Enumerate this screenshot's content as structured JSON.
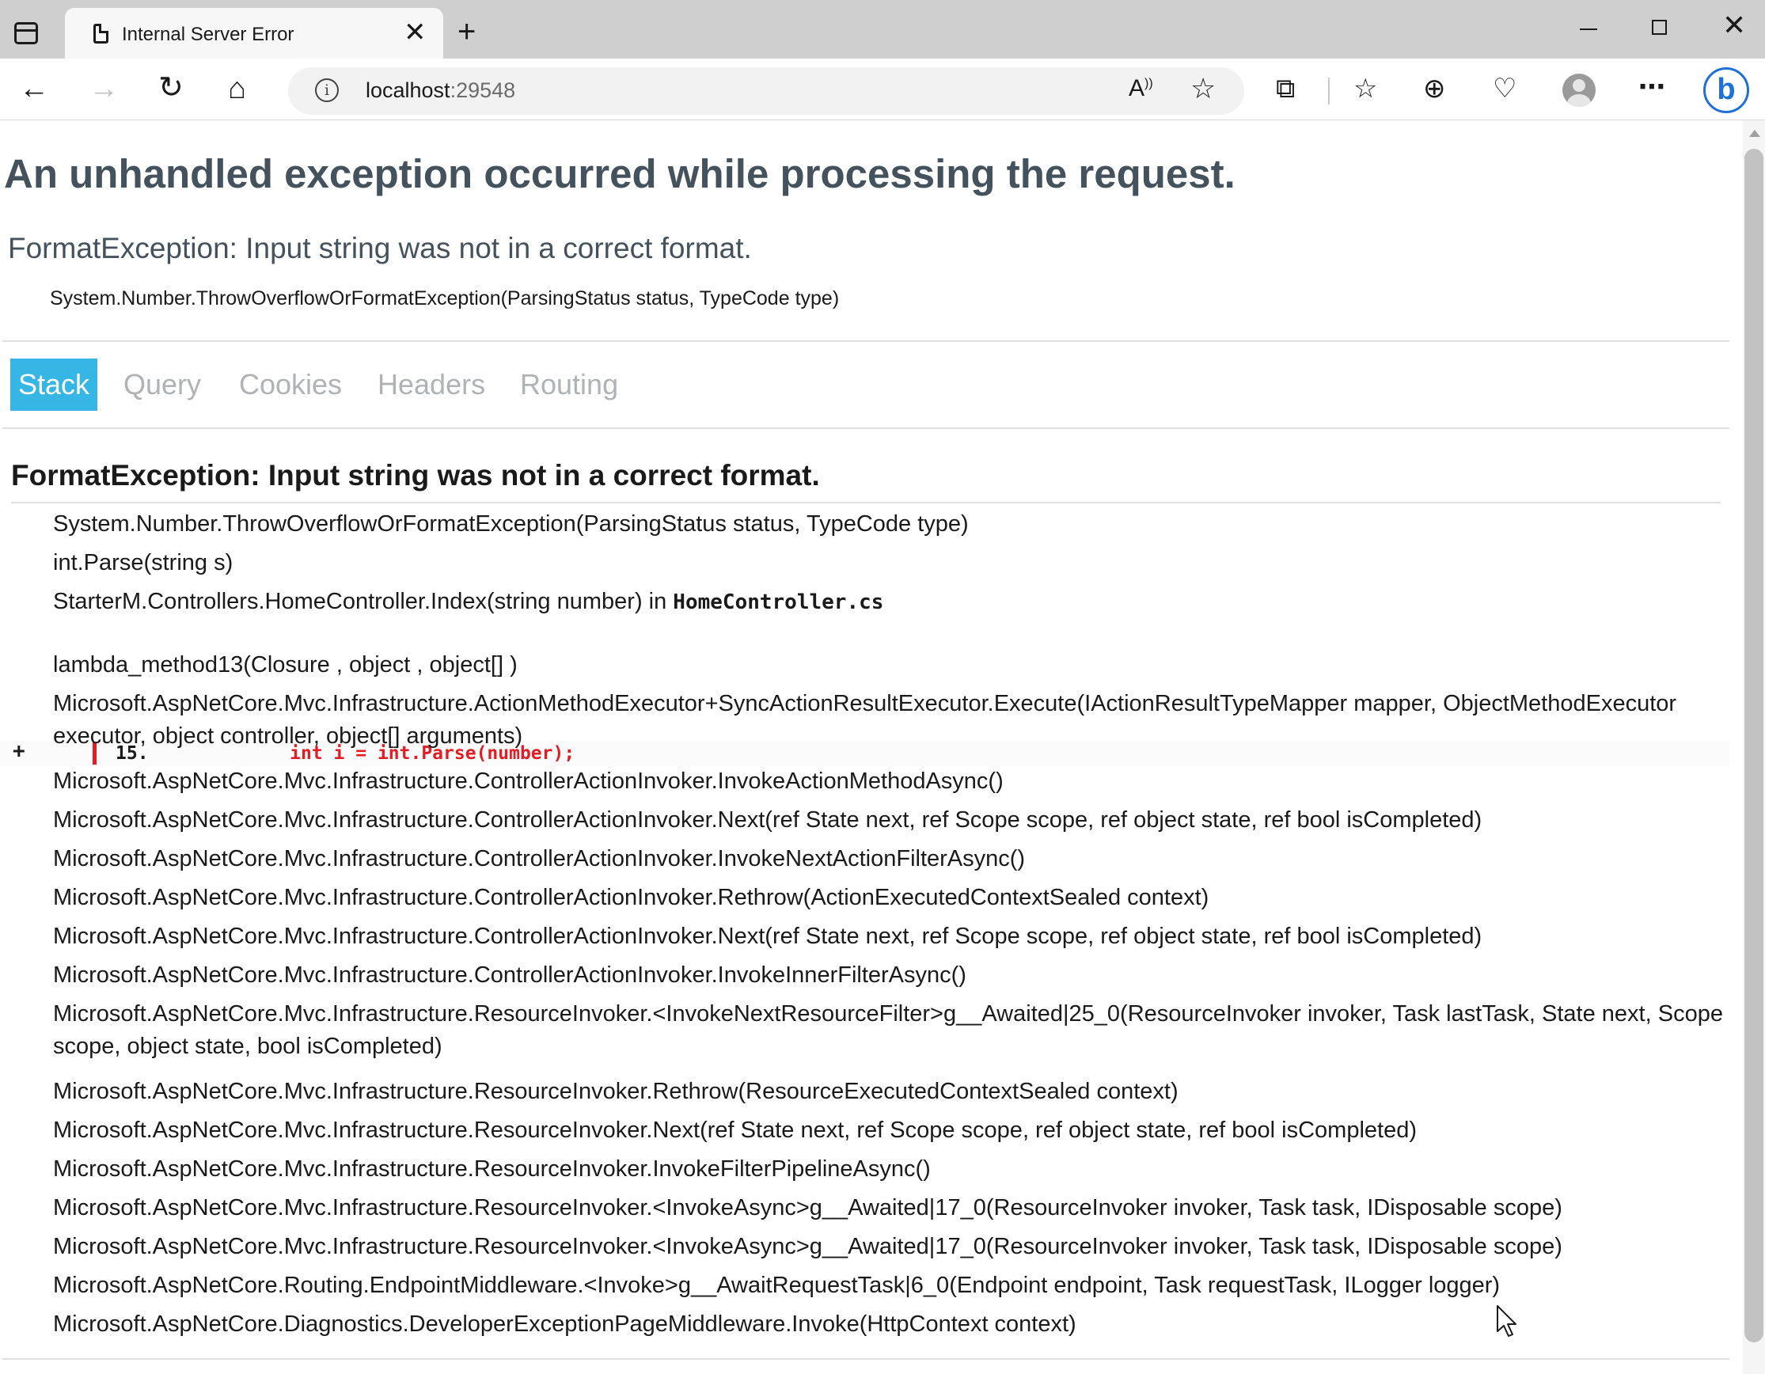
{
  "browser": {
    "tab_title": "Internal Server Error",
    "address_host": "localhost",
    "address_port": ":29548",
    "icons": {
      "sidebar": "sidebar-toggle-icon",
      "tab": "document-icon",
      "back": "back-arrow-icon",
      "forward": "forward-arrow-icon",
      "refresh": "refresh-icon",
      "home": "home-icon",
      "read_aloud": "read-aloud-icon",
      "favorite": "star-icon",
      "extensions": "puzzle-icon",
      "favorites": "favorites-list-icon",
      "collections": "collections-icon",
      "health": "browser-essentials-icon",
      "profile": "profile-avatar-icon",
      "more": "ellipsis-icon",
      "bing": "bing-copilot-icon"
    }
  },
  "page": {
    "heading": "An unhandled exception occurred while processing the request.",
    "title_error": "FormatException: Input string was not in a correct format.",
    "location": "System.Number.ThrowOverflowOrFormatException(ParsingStatus status, TypeCode type)",
    "tabs": [
      "Stack",
      "Query",
      "Cookies",
      "Headers",
      "Routing"
    ],
    "selected_tab": "Stack",
    "selected_tab_color": "#36b6e5",
    "stack_title": "FormatException: Input string was not in a correct format.",
    "frames": [
      "System.Number.ThrowOverflowOrFormatException(ParsingStatus status, TypeCode type)",
      "int.Parse(string s)"
    ],
    "frame_with_source": {
      "method": "StarterM.Controllers.HomeController.Index(string number) in ",
      "file": "HomeController.cs",
      "expand": "+",
      "line_number": "15.",
      "code": "            int i = int.Parse(number);",
      "highlight_color": "#e51c23"
    },
    "frames_after": [
      "lambda_method13(Closure , object , object[] )",
      "Microsoft.AspNetCore.Mvc.Infrastructure.ActionMethodExecutor+SyncActionResultExecutor.Execute(IActionResultTypeMapper mapper, ObjectMethodExecutor executor, object controller, object[] arguments)",
      "Microsoft.AspNetCore.Mvc.Infrastructure.ControllerActionInvoker.InvokeActionMethodAsync()",
      "Microsoft.AspNetCore.Mvc.Infrastructure.ControllerActionInvoker.Next(ref State next, ref Scope scope, ref object state, ref bool isCompleted)",
      "Microsoft.AspNetCore.Mvc.Infrastructure.ControllerActionInvoker.InvokeNextActionFilterAsync()",
      "Microsoft.AspNetCore.Mvc.Infrastructure.ControllerActionInvoker.Rethrow(ActionExecutedContextSealed context)",
      "Microsoft.AspNetCore.Mvc.Infrastructure.ControllerActionInvoker.Next(ref State next, ref Scope scope, ref object state, ref bool isCompleted)",
      "Microsoft.AspNetCore.Mvc.Infrastructure.ControllerActionInvoker.InvokeInnerFilterAsync()",
      "Microsoft.AspNetCore.Mvc.Infrastructure.ResourceInvoker.<InvokeNextResourceFilter>g__Awaited|25_0(ResourceInvoker invoker, Task lastTask, State next, Scope scope, object state, bool isCompleted)",
      "Microsoft.AspNetCore.Mvc.Infrastructure.ResourceInvoker.Rethrow(ResourceExecutedContextSealed context)",
      "Microsoft.AspNetCore.Mvc.Infrastructure.ResourceInvoker.Next(ref State next, ref Scope scope, ref object state, ref bool isCompleted)",
      "Microsoft.AspNetCore.Mvc.Infrastructure.ResourceInvoker.InvokeFilterPipelineAsync()",
      "Microsoft.AspNetCore.Mvc.Infrastructure.ResourceInvoker.<InvokeAsync>g__Awaited|17_0(ResourceInvoker invoker, Task task, IDisposable scope)",
      "Microsoft.AspNetCore.Mvc.Infrastructure.ResourceInvoker.<InvokeAsync>g__Awaited|17_0(ResourceInvoker invoker, Task task, IDisposable scope)",
      "Microsoft.AspNetCore.Routing.EndpointMiddleware.<Invoke>g__AwaitRequestTask|6_0(Endpoint endpoint, Task requestTask, ILogger logger)",
      "Microsoft.AspNetCore.Diagnostics.DeveloperExceptionPageMiddleware.Invoke(HttpContext context)"
    ]
  }
}
